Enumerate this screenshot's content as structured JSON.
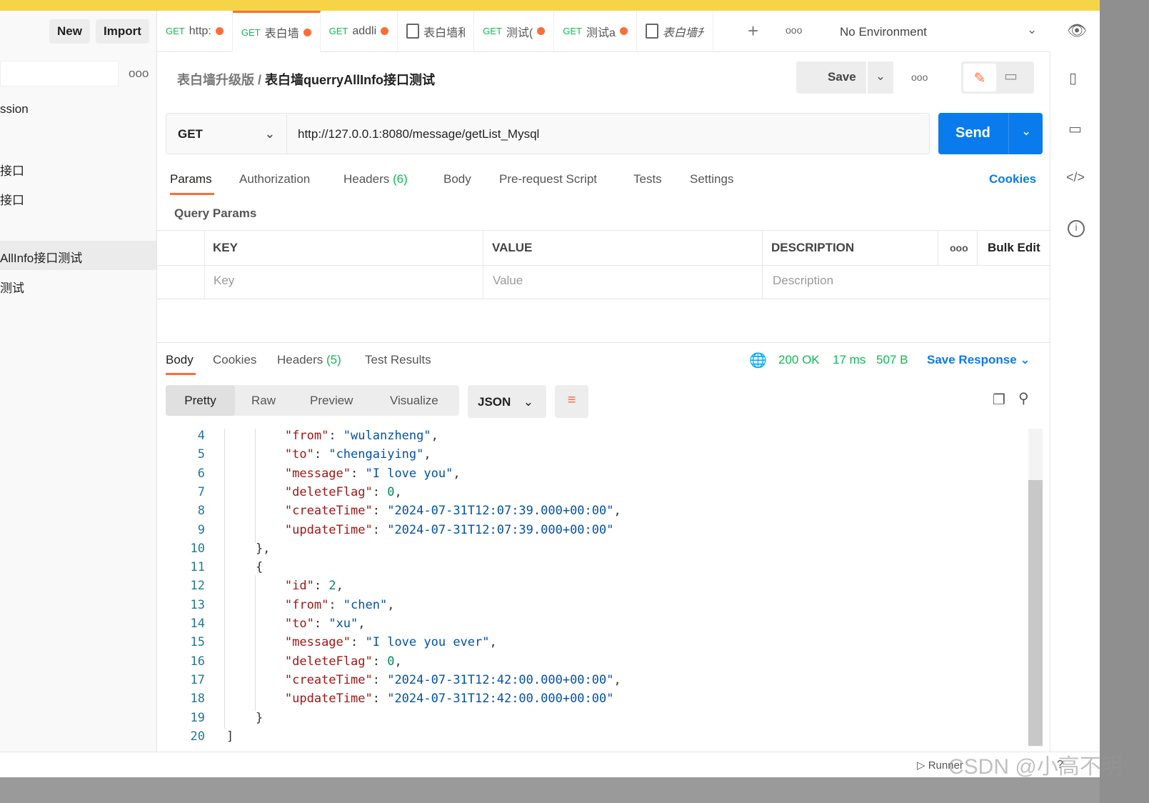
{
  "sidebar": {
    "new": "New",
    "import": "Import",
    "items": [
      "ssion",
      "接口",
      "接口",
      "AllInfo接口测试",
      "测试"
    ],
    "more": "ooo"
  },
  "tabs": [
    {
      "method": "GET",
      "label": "http:",
      "dot": true
    },
    {
      "method": "GET",
      "label": "表白墙",
      "dot": true,
      "active": true
    },
    {
      "method": "GET",
      "label": "addli",
      "dot": true
    },
    {
      "method": "",
      "label": "表白墙和",
      "dot": false,
      "doc": true
    },
    {
      "method": "GET",
      "label": "测试(",
      "dot": true
    },
    {
      "method": "GET",
      "label": "测试a",
      "dot": true
    },
    {
      "method": "",
      "label": "表白墙升",
      "dot": false,
      "doc": true
    }
  ],
  "env": "No Environment",
  "breadcrumb": {
    "parent": "表白墙升级版",
    "sep": "/",
    "current": "表白墙querryAllInfo接口测试"
  },
  "save": "Save",
  "request": {
    "method": "GET",
    "url": "http://127.0.0.1:8080/message/getList_Mysql",
    "send": "Send"
  },
  "reqtabs": {
    "params": "Params",
    "auth": "Authorization",
    "headers": "Headers",
    "headers_count": "(6)",
    "body": "Body",
    "pre": "Pre-request Script",
    "tests": "Tests",
    "settings": "Settings",
    "cookies": "Cookies"
  },
  "query": {
    "title": "Query Params",
    "key": "KEY",
    "value": "VALUE",
    "desc": "DESCRIPTION",
    "bulk": "Bulk Edit",
    "key_ph": "Key",
    "value_ph": "Value",
    "desc_ph": "Description"
  },
  "resp": {
    "body": "Body",
    "cookies": "Cookies",
    "headers": "Headers",
    "headers_count": "(5)",
    "tests": "Test Results",
    "status": "200 OK",
    "time": "17 ms",
    "size": "507 B",
    "save": "Save Response"
  },
  "view": {
    "pretty": "Pretty",
    "raw": "Raw",
    "preview": "Preview",
    "visualize": "Visualize",
    "format": "JSON"
  },
  "code": [
    {
      "n": "4",
      "t": [
        [
          "        ",
          ""
        ],
        [
          "\"from\"",
          "k"
        ],
        [
          ": ",
          ""
        ],
        [
          "\"wulanzheng\"",
          "s"
        ],
        [
          ",",
          ""
        ]
      ]
    },
    {
      "n": "5",
      "t": [
        [
          "        ",
          ""
        ],
        [
          "\"to\"",
          "k"
        ],
        [
          ": ",
          ""
        ],
        [
          "\"chengaiying\"",
          "s"
        ],
        [
          ",",
          ""
        ]
      ]
    },
    {
      "n": "6",
      "t": [
        [
          "        ",
          ""
        ],
        [
          "\"message\"",
          "k"
        ],
        [
          ": ",
          ""
        ],
        [
          "\"I love you\"",
          "s"
        ],
        [
          ",",
          ""
        ]
      ]
    },
    {
      "n": "7",
      "t": [
        [
          "        ",
          ""
        ],
        [
          "\"deleteFlag\"",
          "k"
        ],
        [
          ": ",
          ""
        ],
        [
          "0",
          "n"
        ],
        [
          ",",
          ""
        ]
      ]
    },
    {
      "n": "8",
      "t": [
        [
          "        ",
          ""
        ],
        [
          "\"createTime\"",
          "k"
        ],
        [
          ": ",
          ""
        ],
        [
          "\"2024-07-31T12:07:39.000+00:00\"",
          "s"
        ],
        [
          ",",
          ""
        ]
      ]
    },
    {
      "n": "9",
      "t": [
        [
          "        ",
          ""
        ],
        [
          "\"updateTime\"",
          "k"
        ],
        [
          ": ",
          ""
        ],
        [
          "\"2024-07-31T12:07:39.000+00:00\"",
          "s"
        ]
      ]
    },
    {
      "n": "10",
      "t": [
        [
          "    },",
          ""
        ]
      ]
    },
    {
      "n": "11",
      "t": [
        [
          "    {",
          ""
        ]
      ]
    },
    {
      "n": "12",
      "t": [
        [
          "        ",
          ""
        ],
        [
          "\"id\"",
          "k"
        ],
        [
          ": ",
          ""
        ],
        [
          "2",
          "n"
        ],
        [
          ",",
          ""
        ]
      ]
    },
    {
      "n": "13",
      "t": [
        [
          "        ",
          ""
        ],
        [
          "\"from\"",
          "k"
        ],
        [
          ": ",
          ""
        ],
        [
          "\"chen\"",
          "s"
        ],
        [
          ",",
          ""
        ]
      ]
    },
    {
      "n": "14",
      "t": [
        [
          "        ",
          ""
        ],
        [
          "\"to\"",
          "k"
        ],
        [
          ": ",
          ""
        ],
        [
          "\"xu\"",
          "s"
        ],
        [
          ",",
          ""
        ]
      ]
    },
    {
      "n": "15",
      "t": [
        [
          "        ",
          ""
        ],
        [
          "\"message\"",
          "k"
        ],
        [
          ": ",
          ""
        ],
        [
          "\"I love you ever\"",
          "s"
        ],
        [
          ",",
          ""
        ]
      ]
    },
    {
      "n": "16",
      "t": [
        [
          "        ",
          ""
        ],
        [
          "\"deleteFlag\"",
          "k"
        ],
        [
          ": ",
          ""
        ],
        [
          "0",
          "n"
        ],
        [
          ",",
          ""
        ]
      ]
    },
    {
      "n": "17",
      "t": [
        [
          "        ",
          ""
        ],
        [
          "\"createTime\"",
          "k"
        ],
        [
          ": ",
          ""
        ],
        [
          "\"2024-07-31T12:42:00.000+00:00\"",
          "s"
        ],
        [
          ",",
          ""
        ]
      ]
    },
    {
      "n": "18",
      "t": [
        [
          "        ",
          ""
        ],
        [
          "\"updateTime\"",
          "k"
        ],
        [
          ": ",
          ""
        ],
        [
          "\"2024-07-31T12:42:00.000+00:00\"",
          "s"
        ]
      ]
    },
    {
      "n": "19",
      "t": [
        [
          "    }",
          ""
        ]
      ]
    },
    {
      "n": "20",
      "t": [
        [
          "]",
          ""
        ]
      ]
    }
  ],
  "footer": {
    "runner": "Runner",
    "watermark": "CSDN @小高不明"
  },
  "colors": {
    "accent": "#ff6c37",
    "send": "#097bed",
    "ok": "#0cbb52"
  }
}
